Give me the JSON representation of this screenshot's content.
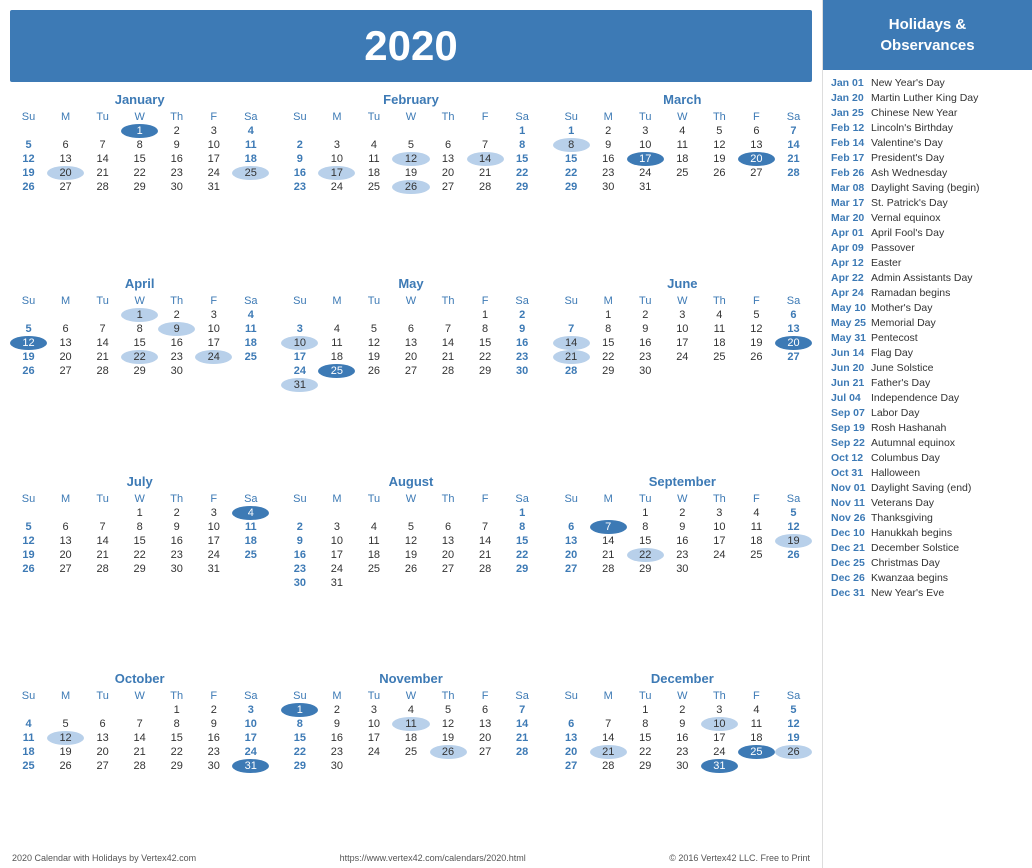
{
  "header": {
    "year": "2020"
  },
  "footer": {
    "left": "2020 Calendar with Holidays by Vertex42.com",
    "center": "https://www.vertex42.com/calendars/2020.html",
    "right": "© 2016 Vertex42 LLC. Free to Print"
  },
  "holidays_header": "Holidays &\nObservances",
  "holidays": [
    {
      "date": "Jan 01",
      "name": "New Year's Day"
    },
    {
      "date": "Jan 20",
      "name": "Martin Luther King Day"
    },
    {
      "date": "Jan 25",
      "name": "Chinese New Year"
    },
    {
      "date": "Feb 12",
      "name": "Lincoln's Birthday"
    },
    {
      "date": "Feb 14",
      "name": "Valentine's Day"
    },
    {
      "date": "Feb 17",
      "name": "President's Day"
    },
    {
      "date": "Feb 26",
      "name": "Ash Wednesday"
    },
    {
      "date": "Mar 08",
      "name": "Daylight Saving (begin)"
    },
    {
      "date": "Mar 17",
      "name": "St. Patrick's Day"
    },
    {
      "date": "Mar 20",
      "name": "Vernal equinox"
    },
    {
      "date": "Apr 01",
      "name": "April Fool's Day"
    },
    {
      "date": "Apr 09",
      "name": "Passover"
    },
    {
      "date": "Apr 12",
      "name": "Easter"
    },
    {
      "date": "Apr 22",
      "name": "Admin Assistants Day"
    },
    {
      "date": "Apr 24",
      "name": "Ramadan begins"
    },
    {
      "date": "May 10",
      "name": "Mother's Day"
    },
    {
      "date": "May 25",
      "name": "Memorial Day"
    },
    {
      "date": "May 31",
      "name": "Pentecost"
    },
    {
      "date": "Jun 14",
      "name": "Flag Day"
    },
    {
      "date": "Jun 20",
      "name": "June Solstice"
    },
    {
      "date": "Jun 21",
      "name": "Father's Day"
    },
    {
      "date": "Jul 04",
      "name": "Independence Day"
    },
    {
      "date": "Sep 07",
      "name": "Labor Day"
    },
    {
      "date": "Sep 19",
      "name": "Rosh Hashanah"
    },
    {
      "date": "Sep 22",
      "name": "Autumnal equinox"
    },
    {
      "date": "Oct 12",
      "name": "Columbus Day"
    },
    {
      "date": "Oct 31",
      "name": "Halloween"
    },
    {
      "date": "Nov 01",
      "name": "Daylight Saving (end)"
    },
    {
      "date": "Nov 11",
      "name": "Veterans Day"
    },
    {
      "date": "Nov 26",
      "name": "Thanksgiving"
    },
    {
      "date": "Dec 10",
      "name": "Hanukkah begins"
    },
    {
      "date": "Dec 21",
      "name": "December Solstice"
    },
    {
      "date": "Dec 25",
      "name": "Christmas Day"
    },
    {
      "date": "Dec 26",
      "name": "Kwanzaa begins"
    },
    {
      "date": "Dec 31",
      "name": "New Year's Eve"
    }
  ],
  "months": [
    {
      "name": "January",
      "days": [
        [
          null,
          null,
          null,
          1,
          2,
          3,
          4
        ],
        [
          5,
          6,
          7,
          8,
          9,
          10,
          11
        ],
        [
          12,
          13,
          14,
          15,
          16,
          17,
          18
        ],
        [
          19,
          20,
          21,
          22,
          23,
          24,
          25
        ],
        [
          26,
          27,
          28,
          29,
          30,
          31,
          null
        ]
      ],
      "highlights": {
        "blue": [
          1
        ],
        "light": [
          20,
          25
        ]
      }
    },
    {
      "name": "February",
      "days": [
        [
          null,
          null,
          null,
          null,
          null,
          null,
          1
        ],
        [
          2,
          3,
          4,
          5,
          6,
          7,
          8
        ],
        [
          9,
          10,
          11,
          12,
          13,
          14,
          15
        ],
        [
          16,
          17,
          18,
          19,
          20,
          21,
          22
        ],
        [
          23,
          24,
          25,
          26,
          27,
          28,
          29
        ]
      ],
      "highlights": {
        "blue": [],
        "light": [
          12,
          14,
          17,
          26
        ]
      }
    },
    {
      "name": "March",
      "days": [
        [
          1,
          2,
          3,
          4,
          5,
          6,
          7
        ],
        [
          8,
          9,
          10,
          11,
          12,
          13,
          14
        ],
        [
          15,
          16,
          17,
          18,
          19,
          20,
          21
        ],
        [
          22,
          23,
          24,
          25,
          26,
          27,
          28
        ],
        [
          29,
          30,
          31,
          null,
          null,
          null,
          null
        ]
      ],
      "highlights": {
        "blue": [
          17,
          20
        ],
        "light": [
          8
        ]
      }
    },
    {
      "name": "April",
      "days": [
        [
          null,
          null,
          null,
          1,
          2,
          3,
          4
        ],
        [
          5,
          6,
          7,
          8,
          9,
          10,
          11
        ],
        [
          12,
          13,
          14,
          15,
          16,
          17,
          18
        ],
        [
          19,
          20,
          21,
          22,
          23,
          24,
          25
        ],
        [
          26,
          27,
          28,
          29,
          30,
          null,
          null
        ]
      ],
      "highlights": {
        "blue": [
          12
        ],
        "light": [
          1,
          9,
          22,
          24
        ]
      }
    },
    {
      "name": "May",
      "days": [
        [
          null,
          null,
          null,
          null,
          null,
          1,
          2
        ],
        [
          3,
          4,
          5,
          6,
          7,
          8,
          9
        ],
        [
          10,
          11,
          12,
          13,
          14,
          15,
          16
        ],
        [
          17,
          18,
          19,
          20,
          21,
          22,
          23
        ],
        [
          24,
          25,
          26,
          27,
          28,
          29,
          30
        ],
        [
          31,
          null,
          null,
          null,
          null,
          null,
          null
        ]
      ],
      "highlights": {
        "blue": [
          25
        ],
        "light": [
          10,
          31
        ]
      }
    },
    {
      "name": "June",
      "days": [
        [
          null,
          1,
          2,
          3,
          4,
          5,
          6
        ],
        [
          7,
          8,
          9,
          10,
          11,
          12,
          13
        ],
        [
          14,
          15,
          16,
          17,
          18,
          19,
          20
        ],
        [
          21,
          22,
          23,
          24,
          25,
          26,
          27
        ],
        [
          28,
          29,
          30,
          null,
          null,
          null,
          null
        ]
      ],
      "highlights": {
        "blue": [
          20
        ],
        "light": [
          14,
          21
        ]
      }
    },
    {
      "name": "July",
      "days": [
        [
          null,
          null,
          null,
          1,
          2,
          3,
          4
        ],
        [
          5,
          6,
          7,
          8,
          9,
          10,
          11
        ],
        [
          12,
          13,
          14,
          15,
          16,
          17,
          18
        ],
        [
          19,
          20,
          21,
          22,
          23,
          24,
          25
        ],
        [
          26,
          27,
          28,
          29,
          30,
          31,
          null
        ]
      ],
      "highlights": {
        "blue": [
          4
        ],
        "light": []
      }
    },
    {
      "name": "August",
      "days": [
        [
          null,
          null,
          null,
          null,
          null,
          null,
          1
        ],
        [
          2,
          3,
          4,
          5,
          6,
          7,
          8
        ],
        [
          9,
          10,
          11,
          12,
          13,
          14,
          15
        ],
        [
          16,
          17,
          18,
          19,
          20,
          21,
          22
        ],
        [
          23,
          24,
          25,
          26,
          27,
          28,
          29
        ],
        [
          30,
          31,
          null,
          null,
          null,
          null,
          null
        ]
      ],
      "highlights": {
        "blue": [],
        "light": []
      }
    },
    {
      "name": "September",
      "days": [
        [
          null,
          null,
          1,
          2,
          3,
          4,
          5
        ],
        [
          6,
          7,
          8,
          9,
          10,
          11,
          12
        ],
        [
          13,
          14,
          15,
          16,
          17,
          18,
          19
        ],
        [
          20,
          21,
          22,
          23,
          24,
          25,
          26
        ],
        [
          27,
          28,
          29,
          30,
          null,
          null,
          null
        ]
      ],
      "highlights": {
        "blue": [
          7
        ],
        "light": [
          19,
          22
        ]
      }
    },
    {
      "name": "October",
      "days": [
        [
          null,
          null,
          null,
          null,
          1,
          2,
          3
        ],
        [
          4,
          5,
          6,
          7,
          8,
          9,
          10
        ],
        [
          11,
          12,
          13,
          14,
          15,
          16,
          17
        ],
        [
          18,
          19,
          20,
          21,
          22,
          23,
          24
        ],
        [
          25,
          26,
          27,
          28,
          29,
          30,
          31
        ]
      ],
      "highlights": {
        "blue": [
          31
        ],
        "light": [
          12
        ]
      }
    },
    {
      "name": "November",
      "days": [
        [
          1,
          2,
          3,
          4,
          5,
          6,
          7
        ],
        [
          8,
          9,
          10,
          11,
          12,
          13,
          14
        ],
        [
          15,
          16,
          17,
          18,
          19,
          20,
          21
        ],
        [
          22,
          23,
          24,
          25,
          26,
          27,
          28
        ],
        [
          29,
          30,
          null,
          null,
          null,
          null,
          null
        ]
      ],
      "highlights": {
        "blue": [
          1
        ],
        "light": [
          11,
          26
        ]
      }
    },
    {
      "name": "December",
      "days": [
        [
          null,
          null,
          1,
          2,
          3,
          4,
          5
        ],
        [
          6,
          7,
          8,
          9,
          10,
          11,
          12
        ],
        [
          13,
          14,
          15,
          16,
          17,
          18,
          19
        ],
        [
          20,
          21,
          22,
          23,
          24,
          25,
          26
        ],
        [
          27,
          28,
          29,
          30,
          31,
          null,
          null
        ]
      ],
      "highlights": {
        "blue": [
          25,
          31
        ],
        "light": [
          10,
          21,
          26
        ]
      }
    }
  ],
  "weekdays": [
    "Su",
    "M",
    "Tu",
    "W",
    "Th",
    "F",
    "Sa"
  ]
}
